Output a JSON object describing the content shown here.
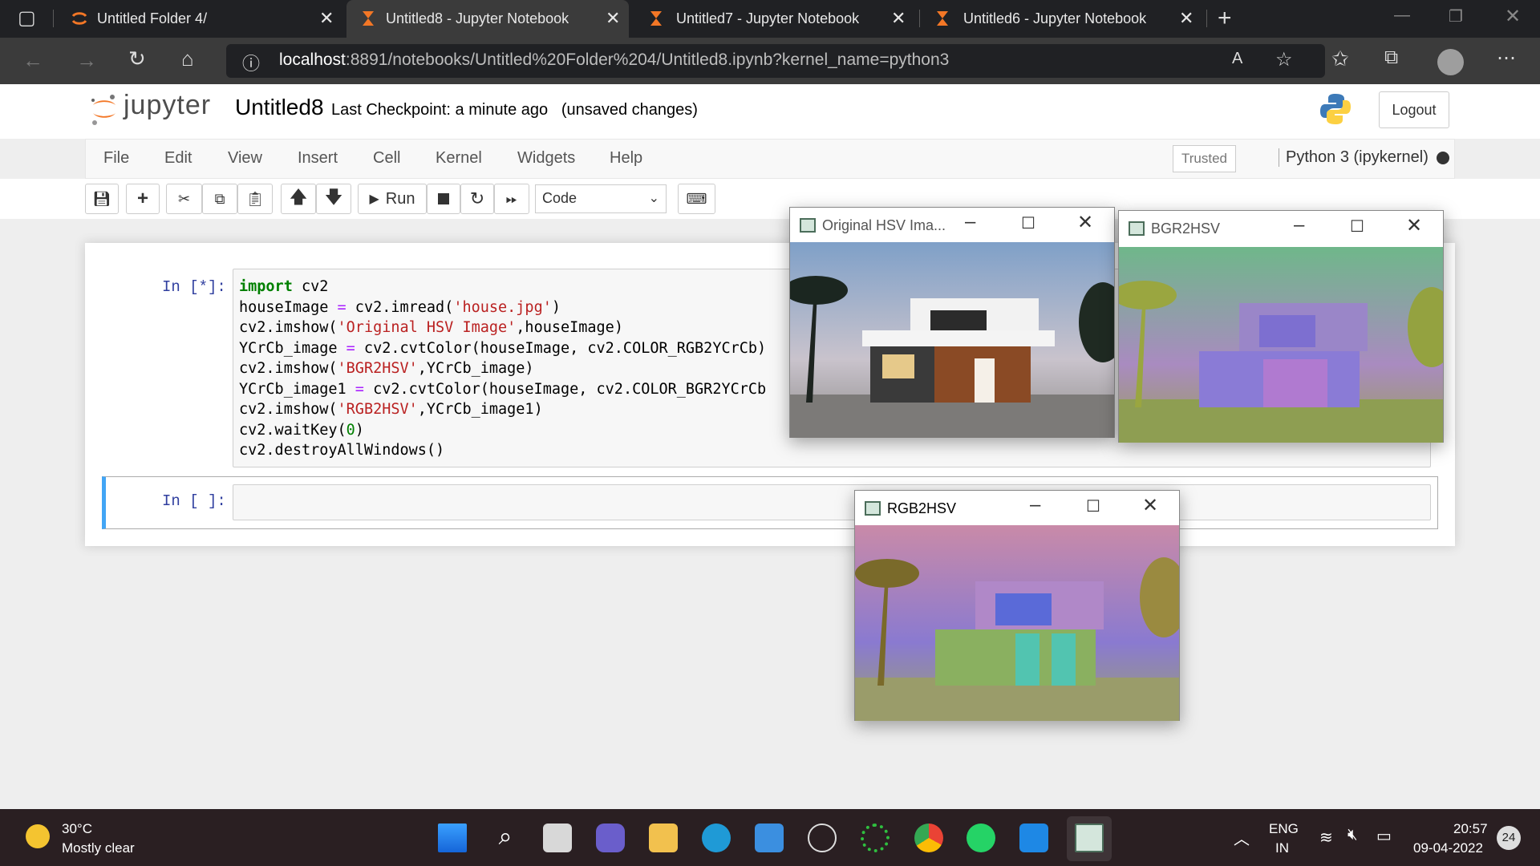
{
  "browser": {
    "tabs": [
      {
        "label": "Untitled Folder 4/"
      },
      {
        "label": "Untitled8 - Jupyter Notebook"
      },
      {
        "label": "Untitled7 - Jupyter Notebook"
      },
      {
        "label": "Untitled6 - Jupyter Notebook"
      }
    ],
    "url_host": "localhost",
    "url_rest": ":8891/notebooks/Untitled%20Folder%204/Untitled8.ipynb?kernel_name=python3"
  },
  "jupyter": {
    "logo_text": "jupyter",
    "notebook_title": "Untitled8",
    "checkpoint": "Last Checkpoint: a minute ago",
    "unsaved": "(unsaved changes)",
    "logout": "Logout",
    "menu": [
      "File",
      "Edit",
      "View",
      "Insert",
      "Cell",
      "Kernel",
      "Widgets",
      "Help"
    ],
    "trusted": "Trusted",
    "kernel": "Python 3 (ipykernel)",
    "run_label": "Run",
    "cell_type": "Code"
  },
  "cells": [
    {
      "prompt": "In [*]:"
    },
    {
      "prompt": "In [ ]:"
    }
  ],
  "windows": {
    "original": {
      "title": "Original HSV Ima..."
    },
    "bgr": {
      "title": "BGR2HSV"
    },
    "rgb": {
      "title": "RGB2HSV"
    }
  },
  "taskbar": {
    "weather_temp": "30°C",
    "weather_desc": "Mostly clear",
    "lang1": "ENG",
    "lang2": "IN",
    "time": "20:57",
    "date": "09-04-2022",
    "notif_count": "24"
  },
  "colors": {
    "accent": "#42a5f5",
    "prompt": "#303f9f",
    "jupyter_orange": "#f37726"
  }
}
